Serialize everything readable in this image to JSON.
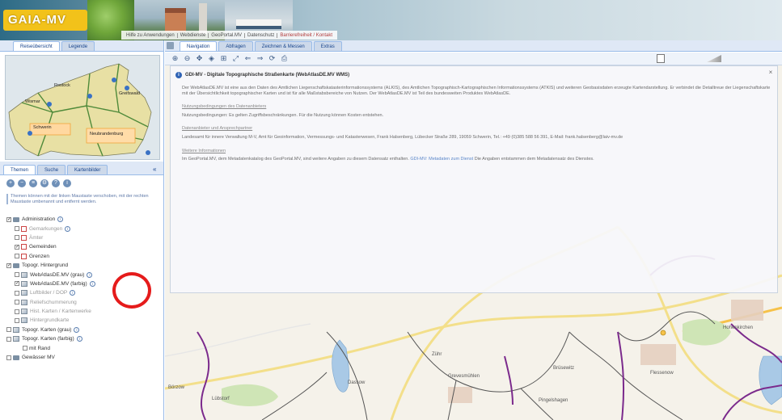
{
  "banner": {
    "logo": "GAIA-MV",
    "links": [
      "Hilfe zu Anwendungen",
      "Webdienste",
      "GeoPortal.MV",
      "Datenschutz",
      "Barrierefreiheit / Kontakt"
    ]
  },
  "left_panel": {
    "top_tabs": [
      "Reiseübersicht",
      "Legende"
    ],
    "overview_labels": [
      "Wismar",
      "Rostock",
      "Greifswald",
      "Schwerin",
      "Neubrandenburg"
    ],
    "lower_tabs": [
      "Themen",
      "Suche",
      "Kartenbilder"
    ],
    "hint": "Themen können mit der linken Maustaste verschoben, mit der rechten Maustaste umbenannt und entfernt werden.",
    "tree": [
      {
        "label": "Administration",
        "type": "folder",
        "checked": true,
        "indent": 0,
        "info": true
      },
      {
        "label": "Gemarkungen",
        "type": "swatch",
        "checked": false,
        "indent": 1,
        "info": true,
        "grey": true
      },
      {
        "label": "Ämter",
        "type": "swatch",
        "checked": false,
        "indent": 1,
        "info": false,
        "grey": true
      },
      {
        "label": "Gemeinden",
        "type": "swatch",
        "checked": true,
        "indent": 1,
        "info": false,
        "grey": false
      },
      {
        "label": "Grenzen",
        "type": "swatch",
        "checked": false,
        "indent": 1,
        "info": false,
        "grey": false
      },
      {
        "label": "Topogr. Hintergrund",
        "type": "folder",
        "checked": true,
        "indent": 0,
        "info": false
      },
      {
        "label": "WebAtlasDE.MV (grau)",
        "type": "layer",
        "checked": false,
        "indent": 1,
        "info": true,
        "grey": false
      },
      {
        "label": "WebAtlasDE.MV (farbig)",
        "type": "layer",
        "checked": true,
        "indent": 1,
        "info": true,
        "grey": false
      },
      {
        "label": "Luftbilder / DOP",
        "type": "layer",
        "checked": false,
        "indent": 1,
        "info": true,
        "grey": true
      },
      {
        "label": "Reliefschummerung",
        "type": "layer",
        "checked": false,
        "indent": 1,
        "info": false,
        "grey": true
      },
      {
        "label": "Hist. Karten / Kartenwerke",
        "type": "layer",
        "checked": false,
        "indent": 1,
        "info": false,
        "grey": true
      },
      {
        "label": "Hintergrundkarte",
        "type": "layer",
        "checked": false,
        "indent": 1,
        "info": false,
        "grey": true
      },
      {
        "label": "Topogr. Karten (grau)",
        "type": "layer",
        "checked": false,
        "indent": 0,
        "info": true,
        "grey": false
      },
      {
        "label": "Topogr. Karten (farbig)",
        "type": "layer",
        "checked": false,
        "indent": 0,
        "info": true,
        "grey": false
      },
      {
        "label": "mit Rand",
        "type": "none",
        "checked": false,
        "indent": 2,
        "info": false,
        "grey": false
      },
      {
        "label": "Gewässer MV",
        "type": "folder",
        "checked": false,
        "indent": 0,
        "info": false,
        "grey": false
      }
    ]
  },
  "right_panel": {
    "tabs": [
      "Navigation",
      "Abfragen",
      "Zeichnen & Messen",
      "Extras"
    ],
    "active_tab": "Navigation",
    "toolbar_icons": [
      "zoom-in-icon",
      "zoom-out-icon",
      "pan-icon",
      "zoom-extent-icon",
      "zoom-box-icon",
      "fullscreen-icon",
      "back-icon",
      "forward-icon",
      "refresh-icon",
      "print-icon"
    ]
  },
  "popup": {
    "title": "GDI-MV - Digitale Topographische Straßenkarte (WebAtlasDE.MV WMS)",
    "intro": "Der WebAtlasDE.MV ist eine aus den Daten des Amtlichen Liegenschaftskatasterinformationssystems (ALKIS), des Amtlichen Topographisch-Kartographischen Informationssystems (ATKIS) und weiteren Geobasisdaten erzeugte Kartendarstellung. Er verbindet die Detailtreue der Liegenschaftskarte mit der Übersichtlichkeit topographischer Karten und ist für alle Maßstabsbereiche von Nutzen. Der WebAtlasDE.MV ist Teil des bundesweiten Produktes WebAtlasDE.",
    "sections": [
      {
        "heading": "Nutzungsbedingungen des Datenanbieters",
        "text": "Nutzungsbedingungen: Es gelten Zugriffsbeschränkungen. Für die Nutzung können Kosten entstehen."
      },
      {
        "heading": "Datenanbieter und Ansprechpartner",
        "text": "Landesamt für innere Verwaltung M-V, Amt für Geoinformation, Vermessungs- und Katasterwesen, Frank Halsenberg, Lübecker Straße 289, 19059 Schwerin, Tel.: +49 (0)385 588 56 391, E-Mail: frank.halsenberg@laiv-mv.de"
      },
      {
        "heading": "Weitere Informationen",
        "text": "Im GeoPortal.MV, dem Metadatenkatalog des GeoPortal.MV, sind weitere Angaben zu diesem Datensatz enthalten."
      }
    ],
    "link_text": "GDI-MV: Metadaten zum Dienst",
    "tail": "Die Angaben entstammen dem Metadatensatz des Dienstes."
  },
  "map": {
    "labels": [
      "Dassow",
      "Grevesmühlen",
      "Zühr",
      "Brüsewitz",
      "Pingelshagen",
      "Flessenow",
      "Lübstorf",
      "Börzow",
      "Hohenkirchen"
    ]
  },
  "colors": {
    "panel_border": "#99bbe8",
    "tab_bg": "#dfe8f6",
    "district_border": "#7b2a8c",
    "highlight_ring": "#e51b1b"
  }
}
